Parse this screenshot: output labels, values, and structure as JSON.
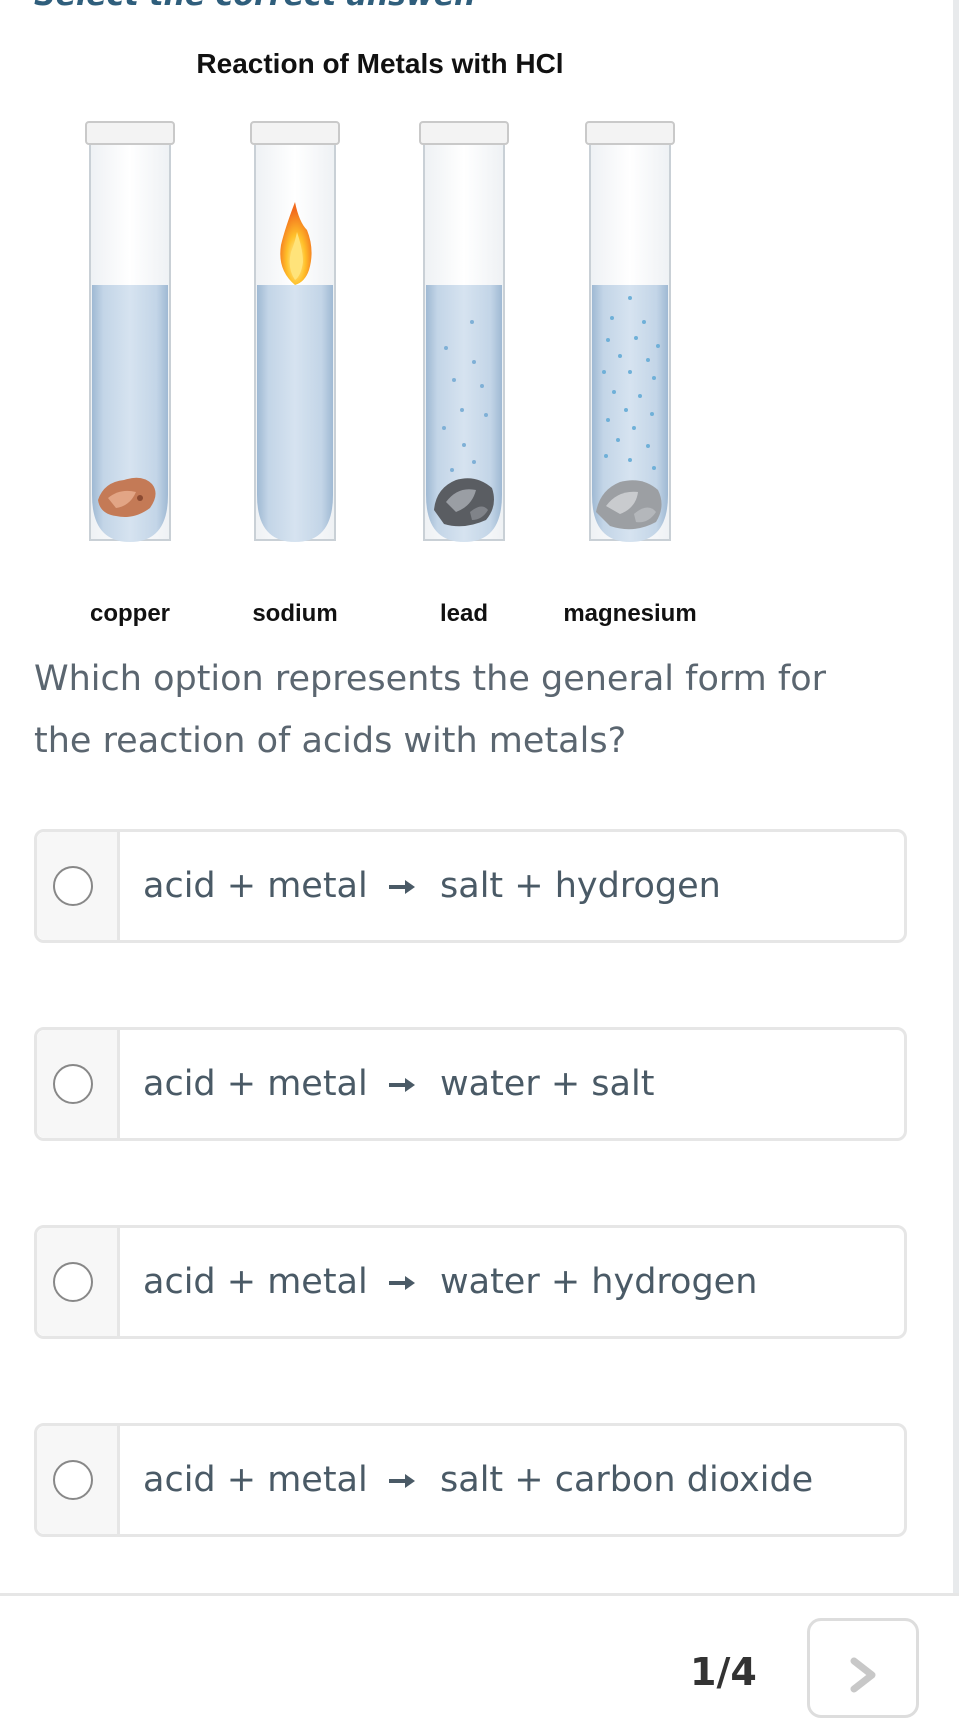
{
  "page": {
    "heading": "Select the correct answer."
  },
  "figure": {
    "title": "Reaction of Metals with HCl",
    "tubes": [
      {
        "label": "copper"
      },
      {
        "label": "sodium"
      },
      {
        "label": "lead"
      },
      {
        "label": "magnesium"
      }
    ]
  },
  "question": "Which option represents the general form for the reaction of acids with metals?",
  "options": [
    {
      "left": "acid + metal",
      "right": "salt + hydrogen"
    },
    {
      "left": "acid + metal",
      "right": "water + salt"
    },
    {
      "left": "acid + metal",
      "right": "water + hydrogen"
    },
    {
      "left": "acid + metal",
      "right": "salt + carbon dioxide"
    }
  ],
  "footer": {
    "counter": "1/4"
  },
  "colors": {
    "liquid": "#b9cee3",
    "heading": "#2f5e7c",
    "text": "#4a5a66"
  },
  "icons": {
    "next": "chevron-right-icon",
    "option_arrow": "arrow-right-icon"
  }
}
